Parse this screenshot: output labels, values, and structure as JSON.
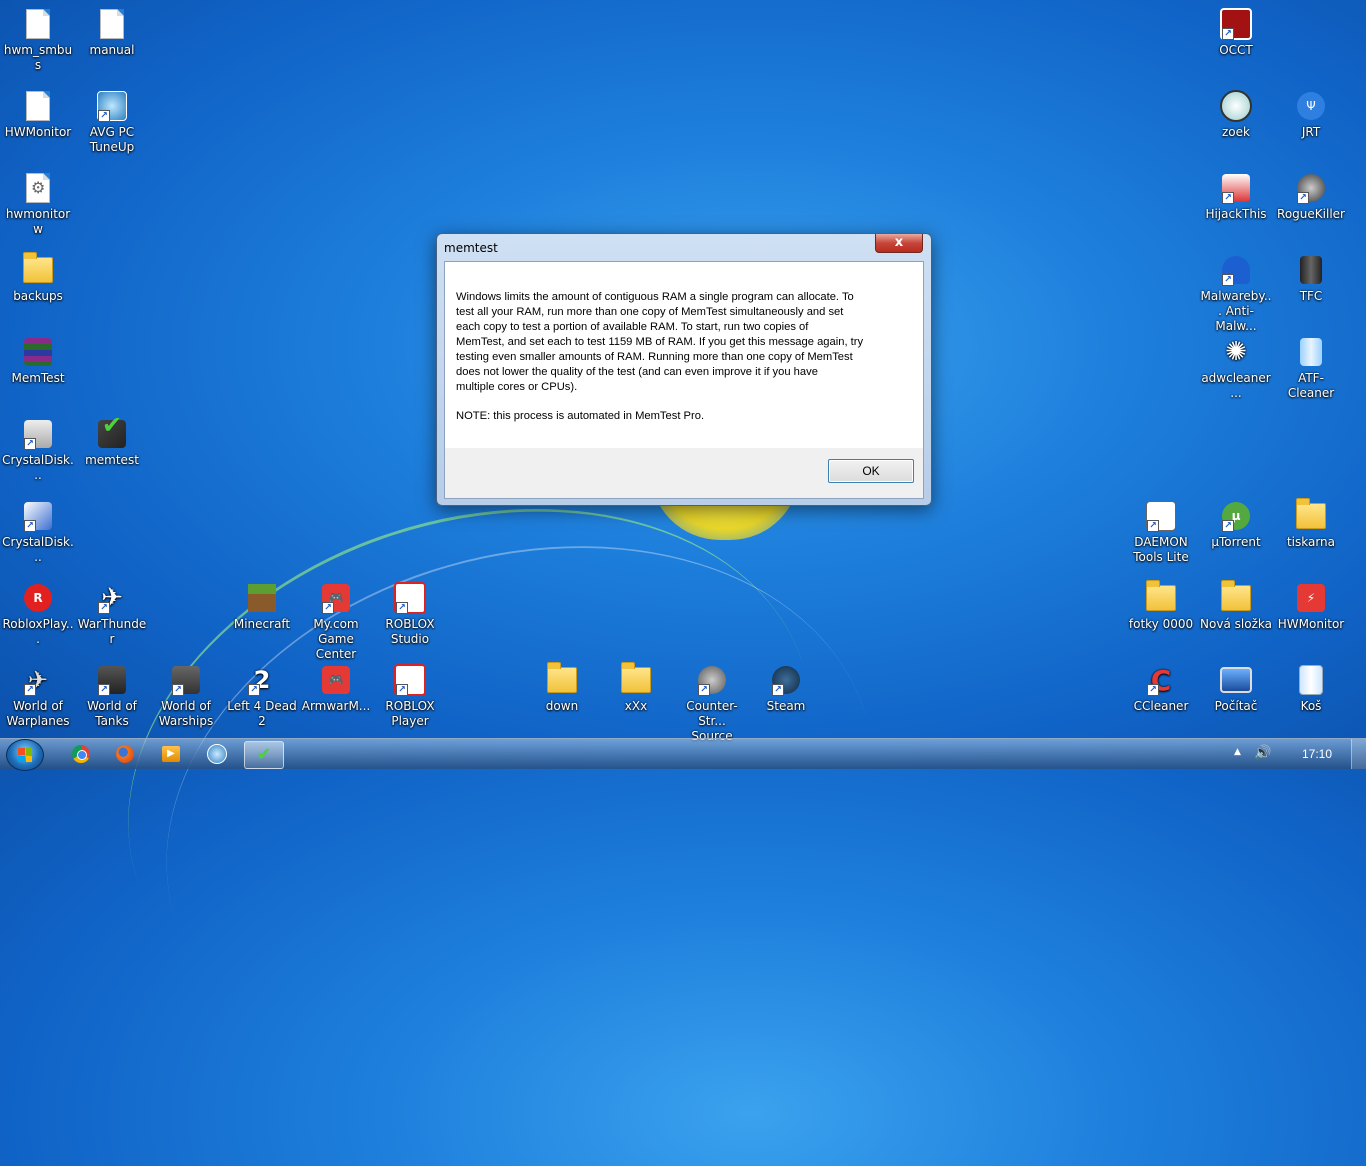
{
  "desktop": {
    "icons": [
      {
        "label": "hwm_smbus",
        "type": "file"
      },
      {
        "label": "manual",
        "type": "file"
      },
      {
        "label": "HWMonitor",
        "type": "file"
      },
      {
        "label": "AVG PC TuneUp",
        "type": "app"
      },
      {
        "label": "hwmonitorw",
        "type": "settings-file"
      },
      {
        "label": "backups",
        "type": "folder"
      },
      {
        "label": "MemTest",
        "type": "archive"
      },
      {
        "label": "CrystalDisk...",
        "type": "app"
      },
      {
        "label": "memtest",
        "type": "app"
      },
      {
        "label": "CrystalDisk...",
        "type": "app"
      },
      {
        "label": "RobloxPlay...",
        "type": "app"
      },
      {
        "label": "WarThunder",
        "type": "game"
      },
      {
        "label": "Minecraft",
        "type": "game"
      },
      {
        "label": "My.com Game Center",
        "type": "game"
      },
      {
        "label": "ROBLOX Studio",
        "type": "app"
      },
      {
        "label": "World of Warplanes",
        "type": "game"
      },
      {
        "label": "World of Tanks",
        "type": "game"
      },
      {
        "label": "World of Warships",
        "type": "game"
      },
      {
        "label": "Left 4 Dead 2",
        "type": "game"
      },
      {
        "label": "ArmwarM...",
        "type": "game"
      },
      {
        "label": "ROBLOX Player",
        "type": "app"
      },
      {
        "label": "down",
        "type": "folder"
      },
      {
        "label": "xXx",
        "type": "folder"
      },
      {
        "label": "Counter-Str... Source",
        "type": "game"
      },
      {
        "label": "Steam",
        "type": "app"
      },
      {
        "label": "OCCT",
        "type": "app"
      },
      {
        "label": "zoek",
        "type": "app"
      },
      {
        "label": "JRT",
        "type": "app"
      },
      {
        "label": "HijackThis",
        "type": "app"
      },
      {
        "label": "RogueKiller",
        "type": "app"
      },
      {
        "label": "Malwareby... Anti-Malw...",
        "type": "app"
      },
      {
        "label": "TFC",
        "type": "app"
      },
      {
        "label": "adwcleaner...",
        "type": "app"
      },
      {
        "label": "ATF-Cleaner",
        "type": "app"
      },
      {
        "label": "DAEMON Tools Lite",
        "type": "app"
      },
      {
        "label": "µTorrent",
        "type": "app"
      },
      {
        "label": "tiskarna",
        "type": "folder"
      },
      {
        "label": "fotky 0000",
        "type": "folder"
      },
      {
        "label": "Nová složka",
        "type": "folder"
      },
      {
        "label": "HWMonitor",
        "type": "app"
      },
      {
        "label": "CCleaner",
        "type": "app"
      },
      {
        "label": "Počítač",
        "type": "computer"
      },
      {
        "label": "Koš",
        "type": "recycle-bin"
      }
    ]
  },
  "dialog": {
    "title": "memtest",
    "close_label": "x",
    "message": "Windows limits the amount of contiguous RAM a single program can allocate. To\ntest all your RAM, run more than one copy of MemTest simultaneously and set\neach copy to test a portion of available RAM. To start, run two copies of\nMemTest, and set each to test 1159 MB of RAM. If you get this message again, try\ntesting even smaller amounts of RAM. Running more than one copy of MemTest\ndoes not lower the quality of the test (and can even improve it if you have\nmultiple cores or CPUs).",
    "note": "NOTE: this process is automated in MemTest Pro.",
    "ok_label": "OK"
  },
  "taskbar": {
    "pinned": [
      "chrome",
      "firefox",
      "media-player",
      "avg-tuneup",
      "memtest"
    ],
    "active_index": 4,
    "clock": "17:10"
  }
}
